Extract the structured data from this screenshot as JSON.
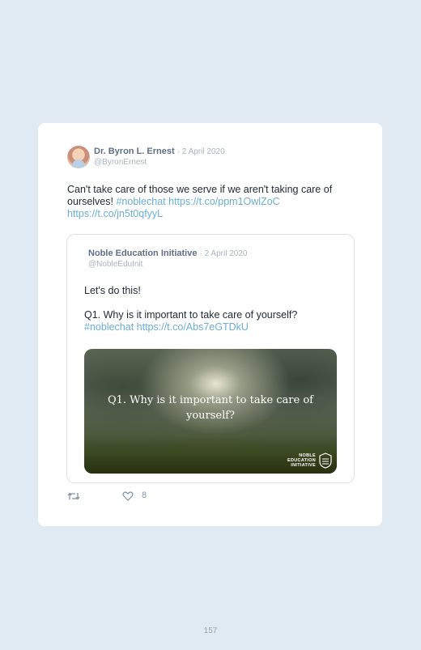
{
  "tweet": {
    "author_name": "Dr. Byron L. Ernest",
    "date": "· 2 April 2020",
    "handle": "@ByronErnest",
    "text_plain": "Can't take care of those we serve if we aren't taking care of ourselves!",
    "hashtag": "#noblechat",
    "link1": "https://t.co/ppm1OwlZoC",
    "link2": "https://t.co/jn5t0qfyyL"
  },
  "quoted_tweet": {
    "author_name": "Noble Education Initiative",
    "date": "· 2 April 2020",
    "handle": "@NobleEduInit",
    "line1": "Let's do this!",
    "line2": "Q1. Why is it important to take care of yourself?",
    "hashtag": "#noblechat",
    "link": "https://t.co/Abs7eGTDkU",
    "image_caption_line1": "Q1. Why is it important to take care of",
    "image_caption_line2": "yourself?",
    "logo_line1": "NOBLE",
    "logo_line2": "EDUCATION",
    "logo_line3": "INITIATIVE"
  },
  "actions": {
    "retweet_icon": "retweet-icon",
    "like_icon": "heart-icon",
    "like_count": "8"
  },
  "page_number": "157",
  "colors": {
    "background": "#dfeaf3",
    "card": "#ffffff",
    "link": "#6aaed6",
    "name": "#5f6f86",
    "muted": "#a7b4c3"
  }
}
